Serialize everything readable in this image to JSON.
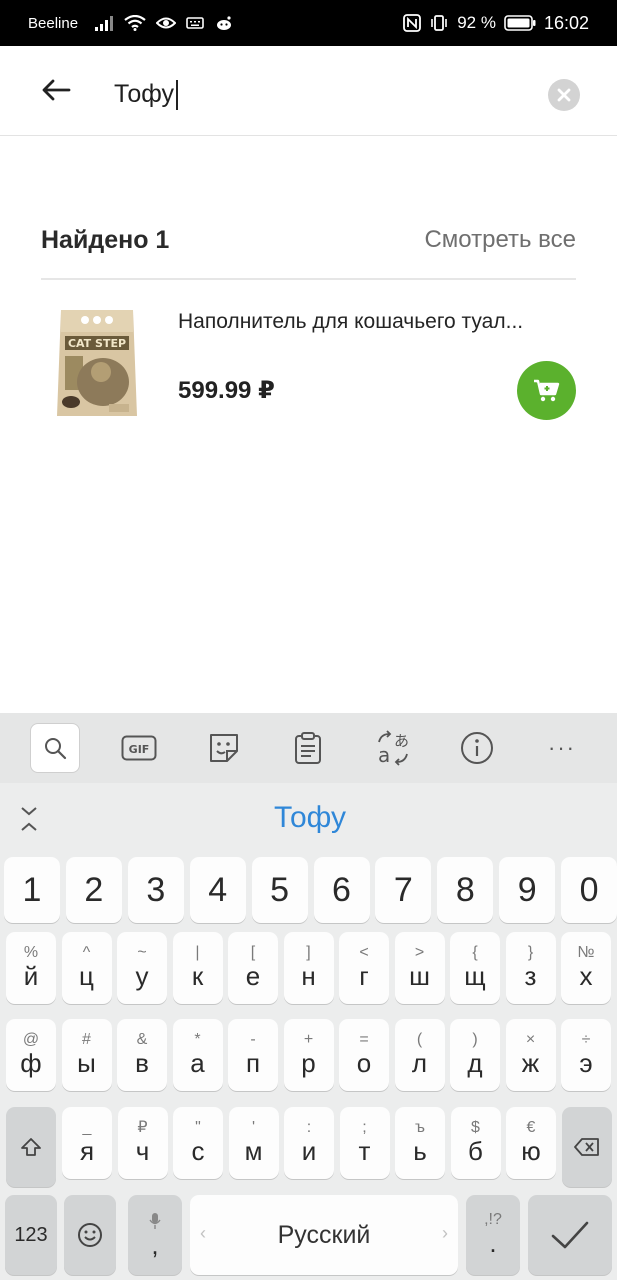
{
  "status_bar": {
    "carrier": "Beeline",
    "battery_percent": "92 %",
    "time": "16:02"
  },
  "search": {
    "query": "Тофу"
  },
  "results": {
    "title": "Найдено 1",
    "view_all": "Смотреть все",
    "items": [
      {
        "name": "Наполнитель для кошачьего туал...",
        "price": "599.99 ₽"
      }
    ]
  },
  "keyboard": {
    "toolbar": [
      "search-icon",
      "gif-icon",
      "sticker-icon",
      "clipboard-icon",
      "translate-icon",
      "info-icon",
      "more-icon"
    ],
    "gif_label": "GIF",
    "more_label": "···",
    "suggestion": "Тофу",
    "number_row": [
      "1",
      "2",
      "3",
      "4",
      "5",
      "6",
      "7",
      "8",
      "9",
      "0"
    ],
    "row1": [
      {
        "main": "й",
        "hint": "%"
      },
      {
        "main": "ц",
        "hint": "^"
      },
      {
        "main": "у",
        "hint": "~"
      },
      {
        "main": "к",
        "hint": "|"
      },
      {
        "main": "е",
        "hint": "["
      },
      {
        "main": "н",
        "hint": "]"
      },
      {
        "main": "г",
        "hint": "<"
      },
      {
        "main": "ш",
        "hint": ">"
      },
      {
        "main": "щ",
        "hint": "{"
      },
      {
        "main": "з",
        "hint": "}"
      },
      {
        "main": "х",
        "hint": "№"
      }
    ],
    "row2": [
      {
        "main": "ф",
        "hint": "@"
      },
      {
        "main": "ы",
        "hint": "#"
      },
      {
        "main": "в",
        "hint": "&"
      },
      {
        "main": "а",
        "hint": "*"
      },
      {
        "main": "п",
        "hint": "-"
      },
      {
        "main": "р",
        "hint": "+"
      },
      {
        "main": "о",
        "hint": "="
      },
      {
        "main": "л",
        "hint": "("
      },
      {
        "main": "д",
        "hint": ")"
      },
      {
        "main": "ж",
        "hint": "×"
      },
      {
        "main": "э",
        "hint": "÷"
      }
    ],
    "row3": [
      {
        "main": "я",
        "hint": "_"
      },
      {
        "main": "ч",
        "hint": "₽"
      },
      {
        "main": "с",
        "hint": "\""
      },
      {
        "main": "м",
        "hint": "'"
      },
      {
        "main": "и",
        "hint": ":"
      },
      {
        "main": "т",
        "hint": ";"
      },
      {
        "main": "ь",
        "hint": "ъ"
      },
      {
        "main": "б",
        "hint": "$"
      },
      {
        "main": "ю",
        "hint": "€"
      }
    ],
    "key_123": "123",
    "comma_key": ",",
    "space_label": "Русский",
    "period_key": ".",
    "period_hint": ",!?"
  }
}
